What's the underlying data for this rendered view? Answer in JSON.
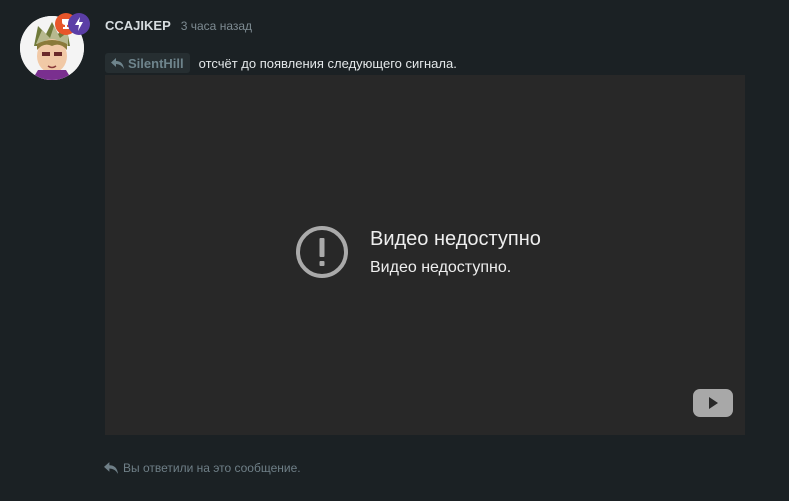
{
  "comment": {
    "author": "CCAJIKEP",
    "timestamp": "3 часа назад",
    "reply_to": "SilentHill",
    "message": "отсчёт до появления следующего сигнала.",
    "badges": [
      {
        "icon": "trophy-icon",
        "color": "#e8562a"
      },
      {
        "icon": "lightning-icon",
        "color": "#5b3ea6"
      }
    ]
  },
  "video": {
    "error_title": "Видео недоступно",
    "error_subtitle": "Видео недоступно.",
    "background": "#282828",
    "play_icon": "youtube-play-icon"
  },
  "footer": {
    "replied_text": "Вы ответили на это сообщение."
  },
  "colors": {
    "page_background": "#1b2124",
    "username": "#d7dde0",
    "muted": "#7e8b92"
  }
}
